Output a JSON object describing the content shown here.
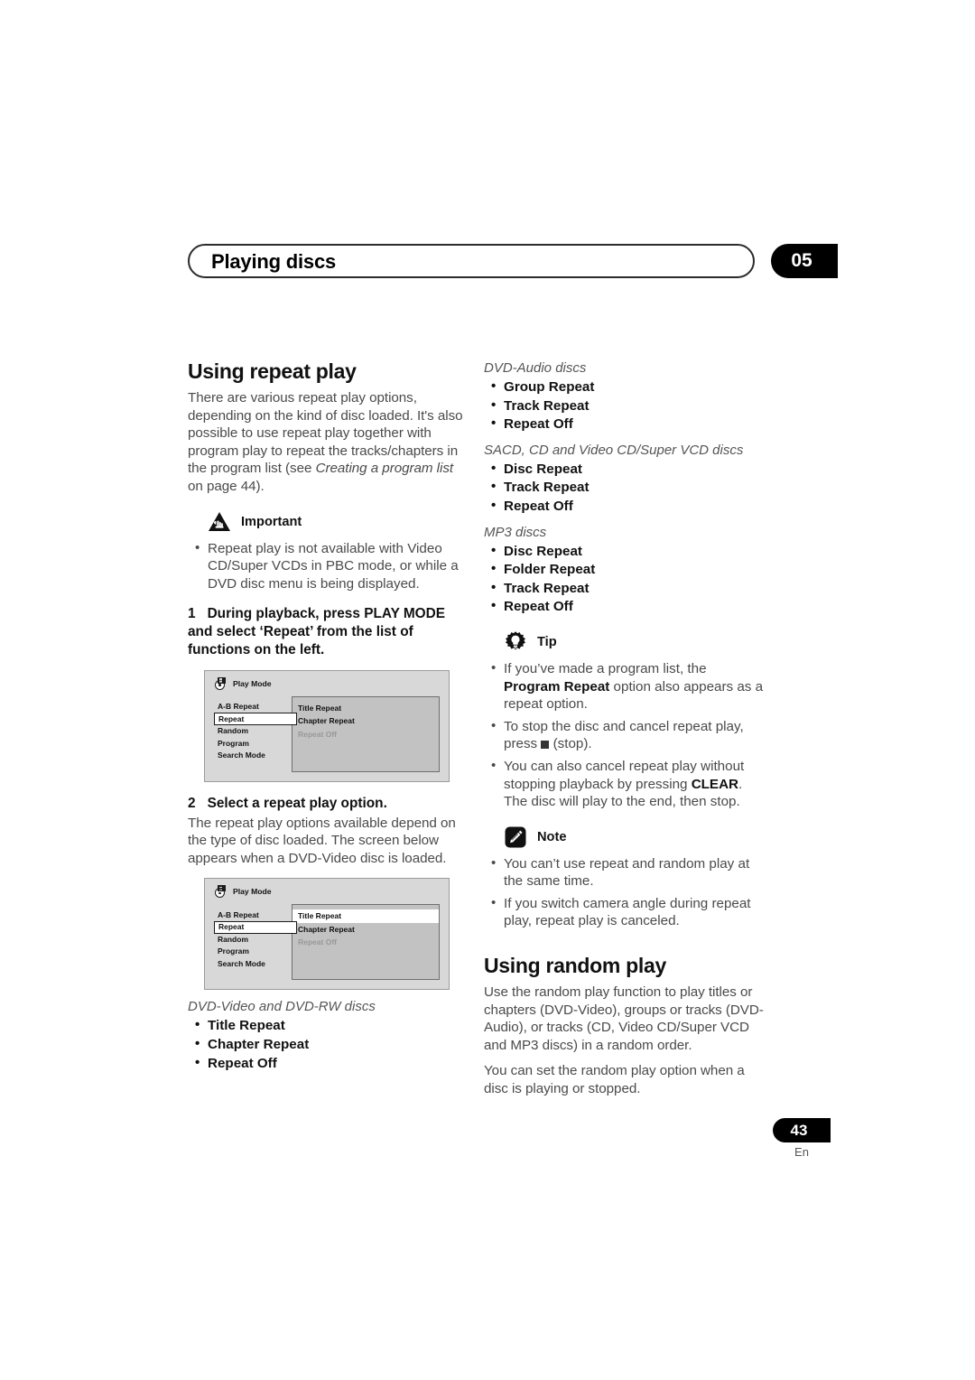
{
  "header": {
    "title": "Playing discs",
    "chapter": "05"
  },
  "left": {
    "section_title": "Using repeat play",
    "intro_pre": "There are various repeat play options, depending on the kind of disc loaded. It's also possible to use repeat play together with program play to repeat the tracks/chapters in the program list (see ",
    "intro_italic": "Creating a program list",
    "intro_post": " on page 44).",
    "important_label": "Important",
    "important_bullets": [
      "Repeat play is not available with Video CD/Super VCDs in PBC mode, or while a DVD disc menu is being displayed."
    ],
    "step1_num": "1",
    "step1_text": "During playback, press PLAY MODE and select ‘Repeat’ from the list of functions on the left.",
    "step2_num": "2",
    "step2_text": "Select a repeat play option.",
    "step2_body": "The repeat play options available depend on the type of disc loaded. The screen below appears when a DVD-Video disc is loaded.",
    "dvd_video_subhead": "DVD-Video and DVD-RW discs",
    "dvd_video_options": [
      "Title Repeat",
      "Chapter Repeat",
      "Repeat Off"
    ]
  },
  "osd": {
    "title": "Play Mode",
    "menu_items": [
      "A-B Repeat",
      "Repeat",
      "Random",
      "Program",
      "Search Mode"
    ],
    "selected_menu_item": "Repeat",
    "panel_items": [
      "Title Repeat",
      "Chapter Repeat",
      "Repeat Off"
    ],
    "disabled_panel_item": "Repeat Off",
    "highlighted_panel_item": "Title Repeat"
  },
  "right": {
    "dvd_audio_subhead": "DVD-Audio discs",
    "dvd_audio_options": [
      "Group Repeat",
      "Track Repeat",
      "Repeat Off"
    ],
    "sacd_subhead": "SACD, CD and Video CD/Super VCD discs",
    "sacd_options": [
      "Disc Repeat",
      "Track Repeat",
      "Repeat Off"
    ],
    "mp3_subhead": "MP3 discs",
    "mp3_options": [
      "Disc Repeat",
      "Folder Repeat",
      "Track Repeat",
      "Repeat Off"
    ],
    "tip_label": "Tip",
    "tip_b1_pre": "If you’ve made a program list, the ",
    "tip_b1_bold": "Program Repeat",
    "tip_b1_post": " option also appears as a repeat option.",
    "tip_b2_pre": "To stop the disc and cancel repeat play, press ",
    "tip_b2_post": " (stop).",
    "tip_b3_pre": "You can also cancel repeat play without stopping playback by pressing ",
    "tip_b3_bold": "CLEAR",
    "tip_b3_post": ". The disc will play to the end, then stop.",
    "note_label": "Note",
    "note_bullets": [
      "You can’t use repeat and random play at the same time.",
      "If you switch camera angle during repeat play, repeat play is canceled."
    ],
    "random_title": "Using random play",
    "random_p1": "Use the random play function to play titles or chapters (DVD-Video), groups or tracks (DVD-Audio), or tracks (CD, Video CD/Super VCD and MP3 discs) in a random order.",
    "random_p2": "You can set the random play option when a disc is playing or stopped."
  },
  "footer": {
    "page_number": "43",
    "language": "En"
  }
}
